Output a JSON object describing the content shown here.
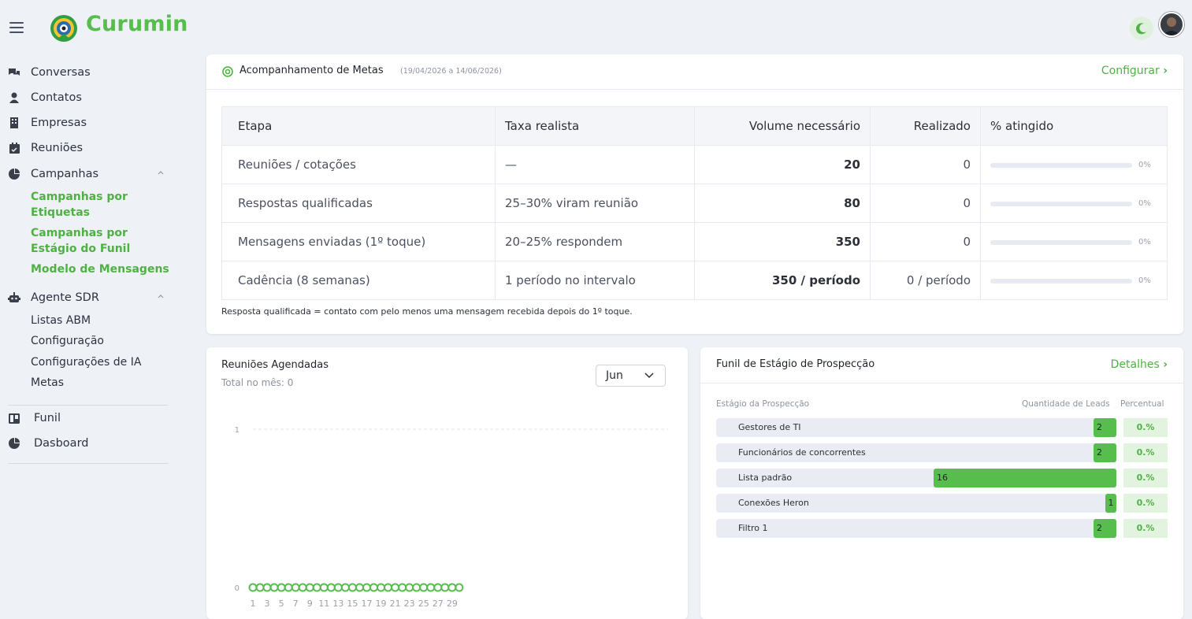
{
  "app": {
    "brand": "Curumin"
  },
  "sidebar": {
    "items": [
      {
        "label": "Conversas",
        "icon": "chat-icon"
      },
      {
        "label": "Contatos",
        "icon": "user-icon"
      },
      {
        "label": "Empresas",
        "icon": "building-icon"
      },
      {
        "label": "Reuniões",
        "icon": "calendar-icon"
      },
      {
        "label": "Campanhas",
        "icon": "pie-chart-icon"
      },
      {
        "label": "Agente SDR",
        "icon": "robot-icon"
      },
      {
        "label": "Funil",
        "icon": "kanban-icon"
      },
      {
        "label": "Dasboard",
        "icon": "pie-chart-icon"
      }
    ],
    "campanhas_sub": [
      "Campanhas por Etiquetas",
      "Campanhas por Estágio do Funil",
      "Modelo de Mensagens"
    ],
    "agente_sub": [
      "Listas ABM",
      "Configuração",
      "Configurações de IA",
      "Metas"
    ]
  },
  "metas": {
    "title": "Acompanhamento de Metas",
    "range": "(19/04/2026 a 14/06/2026)",
    "configure": "Configurar",
    "headers": [
      "Etapa",
      "Taxa realista",
      "Volume necessário",
      "Realizado",
      "% atingido"
    ],
    "rows": [
      {
        "etapa": "Reuniões / cotações",
        "taxa": "—",
        "volume": "20",
        "realizado": "0",
        "pct": "0%",
        "progress": 0
      },
      {
        "etapa": "Respostas qualificadas",
        "taxa": "25–30% viram reunião",
        "volume": "80",
        "realizado": "0",
        "pct": "0%",
        "progress": 0
      },
      {
        "etapa": "Mensagens enviadas (1º toque)",
        "taxa": "20–25% respondem",
        "volume": "350",
        "realizado": "0",
        "pct": "0%",
        "progress": 0
      },
      {
        "etapa": "Cadência (8 semanas)",
        "taxa": "1 período no intervalo",
        "volume": "350 / período",
        "realizado": "0 / período",
        "pct": "0%",
        "progress": 0
      }
    ],
    "note": "Resposta qualificada = contato com pelo menos uma mensagem recebida depois do 1º toque."
  },
  "reunioes": {
    "title": "Reuniões Agendadas",
    "subtitle": "Total no mês: 0",
    "month": "Jun"
  },
  "chart_data": {
    "type": "line",
    "x": [
      1,
      2,
      3,
      4,
      5,
      6,
      7,
      8,
      9,
      10,
      11,
      12,
      13,
      14,
      15,
      16,
      17,
      18,
      19,
      20,
      21,
      22,
      23,
      24,
      25,
      26,
      27,
      28,
      29,
      30
    ],
    "series": [
      {
        "values": [
          0,
          0,
          0,
          0,
          0,
          0,
          0,
          0,
          0,
          0,
          0,
          0,
          0,
          0,
          0,
          0,
          0,
          0,
          0,
          0,
          0,
          0,
          0,
          0,
          0,
          0,
          0,
          0,
          0,
          0
        ]
      }
    ],
    "xticks": [
      "1",
      "3",
      "5",
      "7",
      "9",
      "11",
      "13",
      "15",
      "17",
      "19",
      "21",
      "23",
      "25",
      "27",
      "29"
    ],
    "yticks": [
      "0",
      "1"
    ],
    "ylim": [
      0,
      1
    ],
    "color": "#57bd4d"
  },
  "funil": {
    "title": "Funil de Estágio de Prospecção",
    "details": "Detalhes",
    "col_stage": "Estágio da Prospecção",
    "col_qty": "Quantidade de Leads",
    "col_pct": "Percentual",
    "max": 16,
    "rows": [
      {
        "name": "Gestores de TI",
        "count": 2,
        "pct": "0.%"
      },
      {
        "name": "Funcionários de concorrentes",
        "count": 2,
        "pct": "0.%"
      },
      {
        "name": "Lista padrão",
        "count": 16,
        "pct": "0.%"
      },
      {
        "name": "Conexões Heron",
        "count": 1,
        "pct": "0.%"
      },
      {
        "name": "Filtro 1",
        "count": 2,
        "pct": "0.%"
      }
    ]
  }
}
